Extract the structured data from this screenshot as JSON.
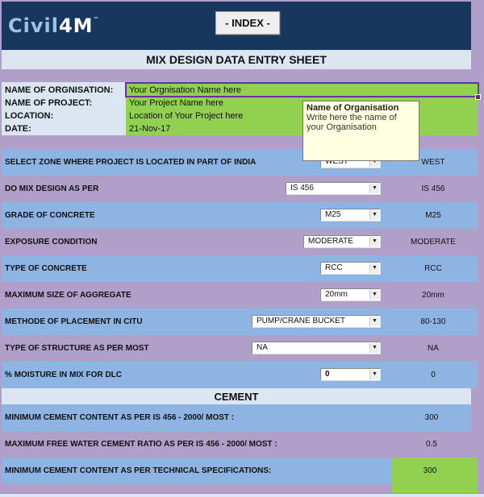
{
  "header": {
    "logo_main": "Civil",
    "logo_accent": "4M",
    "logo_tm": "™",
    "index_button": "- INDEX -"
  },
  "title": "MIX DESIGN DATA ENTRY SHEET",
  "info": [
    {
      "label": "NAME OF ORGNISATION:",
      "value": "Your Orgnisation Name here"
    },
    {
      "label": "NAME OF PROJECT:",
      "value": "Your Project Name here"
    },
    {
      "label": "LOCATION:",
      "value": "Location of Your Project here"
    },
    {
      "label": "DATE:",
      "value": "21-Nov-17"
    }
  ],
  "tooltip": {
    "title": "Name of Organisation",
    "body": "Write here the name of your Organisation"
  },
  "rows": [
    {
      "label": "SELECT ZONE WHERE PROJECT  IS LOCATED IN PART OF INDIA",
      "selected": "WEST",
      "result": "WEST"
    },
    {
      "label": "DO MIX DESIGN AS PER",
      "selected": "IS 456",
      "result": "IS 456"
    },
    {
      "label": "GRADE OF CONCRETE",
      "selected": "M25",
      "result": "M25"
    },
    {
      "label": "EXPOSURE CONDITION",
      "selected": "MODERATE",
      "result": "MODERATE"
    },
    {
      "label": "TYPE OF CONCRETE",
      "selected": "RCC",
      "result": "RCC"
    },
    {
      "label": "MAXIMUM SIZE OF AGGREGATE",
      "selected": "20mm",
      "result": "20mm"
    },
    {
      "label": "METHODE OF PLACEMENT IN CITU",
      "selected": "PUMP/CRANE BUCKET",
      "result": "80-130"
    },
    {
      "label": "TYPE OF STRUCTURE AS PER MOST",
      "selected": "NA",
      "result": "NA"
    },
    {
      "label": "% MOISTURE IN MIX FOR DLC",
      "selected": "0",
      "result": "0"
    }
  ],
  "cement": {
    "heading": "CEMENT",
    "rows": [
      {
        "label": "MINIMUM CEMENT CONTENT AS PER  IS 456 - 2000/ MOST :",
        "value": "300"
      },
      {
        "label": "MAXIMUM FREE WATER CEMENT RATIO AS PER  IS 456 - 2000/ MOST :",
        "value": "0.5"
      },
      {
        "label": "MINIMUM CEMENT CONTENT AS PER TECHNICAL SPECIFICATIONS:",
        "value": "300"
      }
    ]
  },
  "colors": {
    "header_bg": "#17375e",
    "input_green": "#92d050",
    "row_blue": "#8db4e2",
    "row_purple": "#b09fc8",
    "band_light": "#dce6f1"
  }
}
